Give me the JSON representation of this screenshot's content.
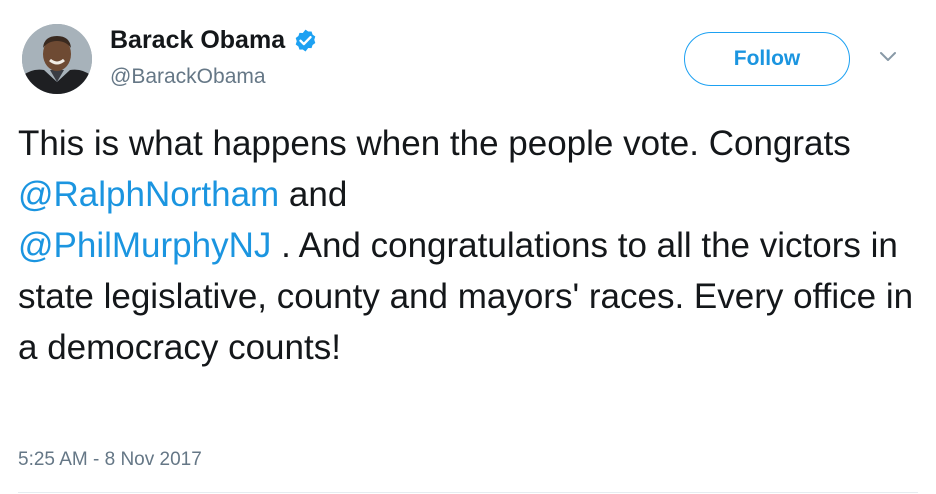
{
  "author": {
    "name": "Barack Obama",
    "handle": "@BarackObama",
    "verified": true
  },
  "follow_button": {
    "label": "Follow"
  },
  "menu_icon": "chevron-down-icon",
  "tweet": {
    "text_1": "This is what happens when the people vote. Congrats ",
    "mention_1": "@RalphNortham",
    "text_2": " and ",
    "mention_2": "@PhilMurphyNJ",
    "text_3": " . And congratulations to all the victors in state legislative, county and mayors' races. Every office in a democracy counts!"
  },
  "timestamp": "5:25 AM - 8 Nov 2017",
  "colors": {
    "accent": "#1b95e0",
    "verified": "#1da1f2",
    "text": "#14171a",
    "secondary_text": "#657786"
  }
}
